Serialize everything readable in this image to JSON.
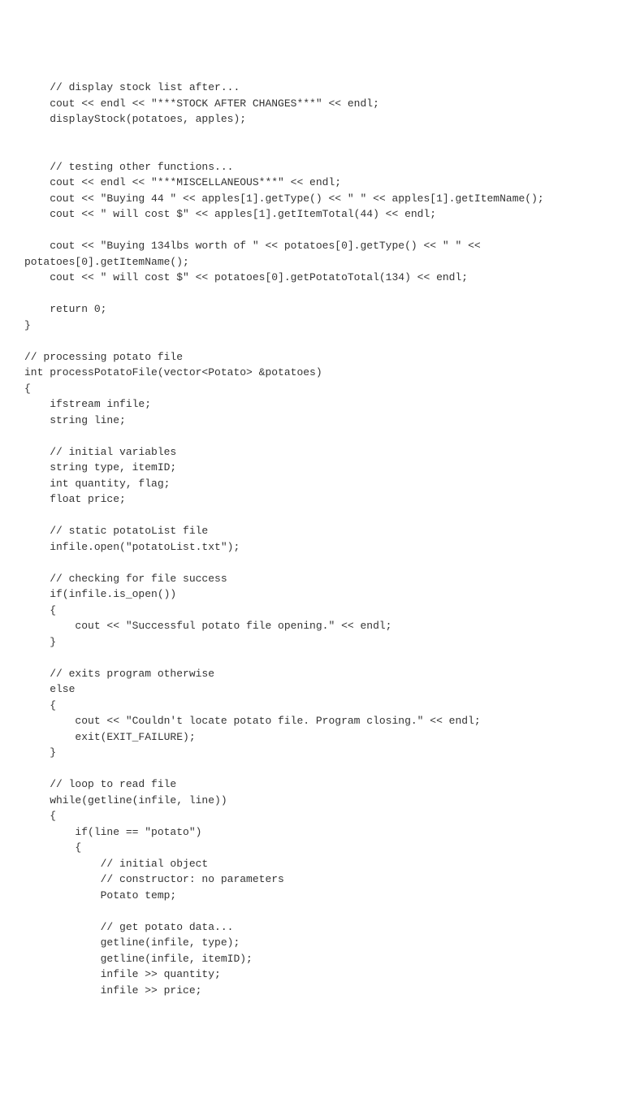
{
  "code_lines": [
    "    // display stock list after...",
    "    cout << endl << \"***STOCK AFTER CHANGES***\" << endl;",
    "    displayStock(potatoes, apples);",
    "",
    "",
    "    // testing other functions...",
    "    cout << endl << \"***MISCELLANEOUS***\" << endl;",
    "    cout << \"Buying 44 \" << apples[1].getType() << \" \" << apples[1].getItemName();",
    "    cout << \" will cost $\" << apples[1].getItemTotal(44) << endl;",
    "",
    "    cout << \"Buying 134lbs worth of \" << potatoes[0].getType() << \" \" <<",
    "potatoes[0].getItemName();",
    "    cout << \" will cost $\" << potatoes[0].getPotatoTotal(134) << endl;",
    "",
    "    return 0;",
    "}",
    "",
    "// processing potato file",
    "int processPotatoFile(vector<Potato> &potatoes)",
    "{",
    "    ifstream infile;",
    "    string line;",
    "",
    "    // initial variables",
    "    string type, itemID;",
    "    int quantity, flag;",
    "    float price;",
    "",
    "    // static potatoList file",
    "    infile.open(\"potatoList.txt\");",
    "",
    "    // checking for file success",
    "    if(infile.is_open())",
    "    {",
    "        cout << \"Successful potato file opening.\" << endl;",
    "    }",
    "",
    "    // exits program otherwise",
    "    else",
    "    {",
    "        cout << \"Couldn't locate potato file. Program closing.\" << endl;",
    "        exit(EXIT_FAILURE);",
    "    }",
    "",
    "    // loop to read file",
    "    while(getline(infile, line))",
    "    {",
    "        if(line == \"potato\")",
    "        {",
    "            // initial object",
    "            // constructor: no parameters",
    "            Potato temp;",
    "",
    "            // get potato data...",
    "            getline(infile, type);",
    "            getline(infile, itemID);",
    "            infile >> quantity;",
    "            infile >> price;"
  ]
}
